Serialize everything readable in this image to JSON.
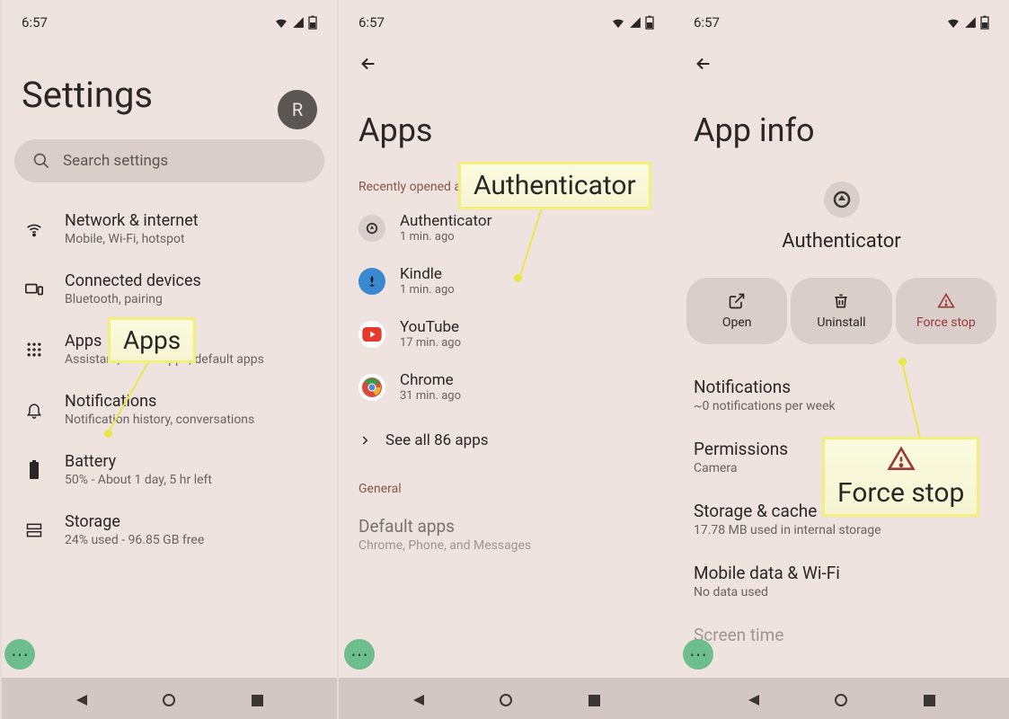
{
  "status": {
    "time": "6:57"
  },
  "screen1": {
    "title": "Settings",
    "avatar_letter": "R",
    "search_placeholder": "Search settings",
    "items": [
      {
        "title": "Network & internet",
        "sub": "Mobile, Wi-Fi, hotspot"
      },
      {
        "title": "Connected devices",
        "sub": "Bluetooth, pairing"
      },
      {
        "title": "Apps",
        "sub": "Assistant, recent apps, default apps"
      },
      {
        "title": "Notifications",
        "sub": "Notification history, conversations"
      },
      {
        "title": "Battery",
        "sub": "50% - About 1 day, 5 hr left"
      },
      {
        "title": "Storage",
        "sub": "24% used - 96.85 GB free"
      }
    ]
  },
  "screen2": {
    "title": "Apps",
    "section_recent": "Recently opened apps",
    "apps": [
      {
        "name": "Authenticator",
        "sub": "1 min. ago"
      },
      {
        "name": "Kindle",
        "sub": "1 min. ago"
      },
      {
        "name": "YouTube",
        "sub": "17 min. ago"
      },
      {
        "name": "Chrome",
        "sub": "31 min. ago"
      }
    ],
    "see_all": "See all 86 apps",
    "section_general": "General",
    "default_apps_title": "Default apps",
    "default_apps_sub": "Chrome, Phone, and Messages"
  },
  "screen3": {
    "title": "App info",
    "app_name": "Authenticator",
    "actions": {
      "open": "Open",
      "uninstall": "Uninstall",
      "force_stop": "Force stop"
    },
    "sections": [
      {
        "title": "Notifications",
        "sub": "~0 notifications per week"
      },
      {
        "title": "Permissions",
        "sub": "Camera"
      },
      {
        "title": "Storage & cache",
        "sub": "17.78 MB used in internal storage"
      },
      {
        "title": "Mobile data & Wi-Fi",
        "sub": "No data used"
      },
      {
        "title": "Screen time",
        "sub": ""
      }
    ]
  },
  "callouts": {
    "apps": "Apps",
    "authenticator": "Authenticator",
    "force_stop": "Force stop"
  }
}
